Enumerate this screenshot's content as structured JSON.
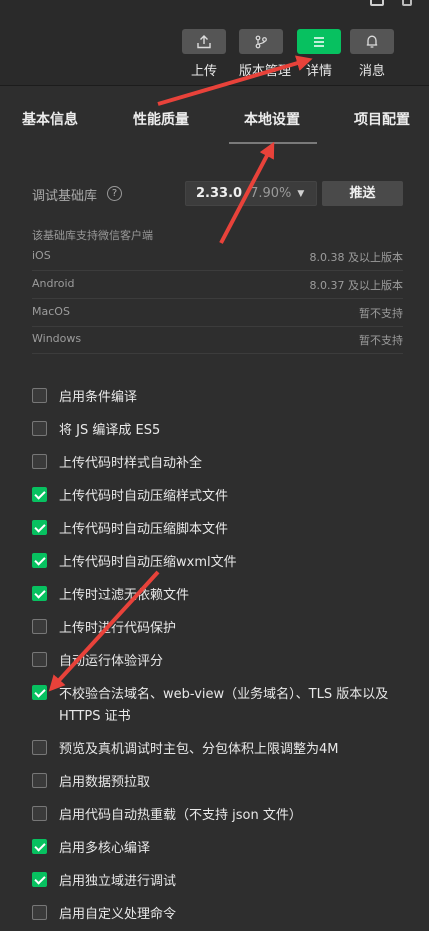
{
  "toolbar": {
    "buttons": [
      {
        "label": "上传",
        "icon": "upload-icon",
        "active": false
      },
      {
        "label": "版本管理",
        "icon": "branch-icon",
        "active": false
      },
      {
        "label": "详情",
        "icon": "menu-icon",
        "active": true
      },
      {
        "label": "消息",
        "icon": "bell-icon",
        "active": false
      }
    ]
  },
  "tabs": [
    {
      "label": "基本信息"
    },
    {
      "label": "性能质量"
    },
    {
      "label": "本地设置",
      "selected": true
    },
    {
      "label": "项目配置"
    }
  ],
  "base_lib": {
    "label": "调试基础库",
    "version": "2.33.0",
    "percent": "7.90%",
    "push_label": "推送"
  },
  "support": {
    "title": "该基础库支持微信客户端",
    "rows": [
      {
        "name": "iOS",
        "value": "8.0.38 及以上版本"
      },
      {
        "name": "Android",
        "value": "8.0.37 及以上版本"
      },
      {
        "name": "MacOS",
        "value": "暂不支持"
      },
      {
        "name": "Windows",
        "value": "暂不支持"
      }
    ]
  },
  "options": [
    {
      "label": "启用条件编译",
      "checked": false
    },
    {
      "label": "将 JS 编译成 ES5",
      "checked": false
    },
    {
      "label": "上传代码时样式自动补全",
      "checked": false
    },
    {
      "label": "上传代码时自动压缩样式文件",
      "checked": true
    },
    {
      "label": "上传代码时自动压缩脚本文件",
      "checked": true
    },
    {
      "label": "上传代码时自动压缩wxml文件",
      "checked": true
    },
    {
      "label": "上传时过滤无依赖文件",
      "checked": true
    },
    {
      "label": "上传时进行代码保护",
      "checked": false
    },
    {
      "label": "自动运行体验评分",
      "checked": false
    },
    {
      "label": "不校验合法域名、web-view（业务域名）、TLS 版本以及 HTTPS 证书",
      "checked": true
    },
    {
      "label": "预览及真机调试时主包、分包体积上限调整为4M",
      "checked": false
    },
    {
      "label": "启用数据预拉取",
      "checked": false
    },
    {
      "label": "启用代码自动热重载（不支持 json 文件）",
      "checked": false
    },
    {
      "label": "启用多核心编译",
      "checked": true
    },
    {
      "label": "启用独立域进行调试",
      "checked": true
    },
    {
      "label": "启用自定义处理命令",
      "checked": false
    }
  ],
  "colors": {
    "accent": "#07c160",
    "annotation_arrow": "#e8423a",
    "background": "#2e2e2e"
  }
}
